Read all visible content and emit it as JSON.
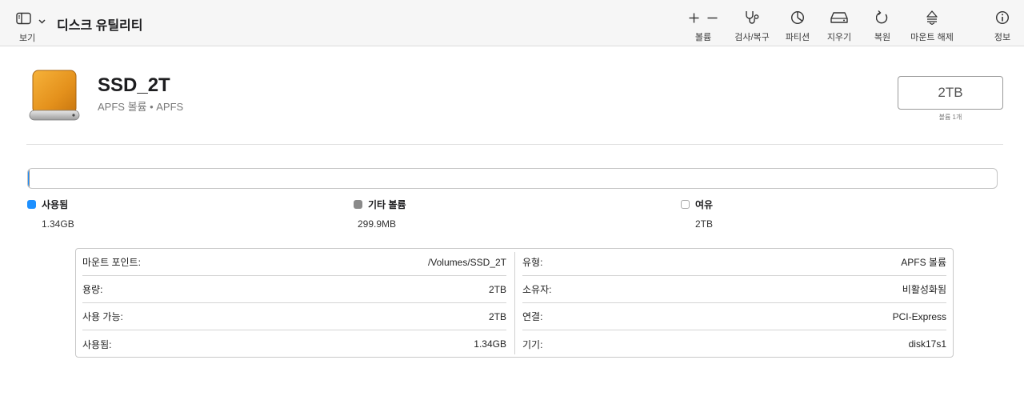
{
  "toolbar": {
    "view_label": "보기",
    "app_title": "디스크 유틸리티",
    "buttons": {
      "volume": "볼륨",
      "first_aid": "검사/복구",
      "partition": "파티션",
      "erase": "지우기",
      "restore": "복원",
      "unmount": "마운트 해제",
      "info": "정보"
    },
    "icons": {
      "view": "sidebar-icon",
      "view_menu": "chevron-down-icon",
      "add": "plus-icon",
      "remove": "minus-icon",
      "first_aid": "stethoscope-icon",
      "partition": "pie-chart-icon",
      "erase": "erase-drive-icon",
      "restore": "restore-arrow-icon",
      "unmount": "eject-icon",
      "info": "info-circle-icon"
    }
  },
  "volume": {
    "name": "SSD_2T",
    "subtitle": "APFS 볼륨 • APFS",
    "capacity": "2TB",
    "volume_count": "볼륨 1개",
    "icon": "external-drive-icon"
  },
  "usage": {
    "used_fraction": 0.00067,
    "other_fraction": 0.00015,
    "legend": [
      {
        "label": "사용됨",
        "value": "1.34GB",
        "color": "#1e90ff"
      },
      {
        "label": "기타 볼륨",
        "value": "299.9MB",
        "color": "#8a8a8a"
      },
      {
        "label": "여유",
        "value": "2TB",
        "color": "#ffffff"
      }
    ]
  },
  "info": {
    "left": [
      {
        "label": "마운트 포인트:",
        "value": "/Volumes/SSD_2T"
      },
      {
        "label": "용량:",
        "value": "2TB"
      },
      {
        "label": "사용 가능:",
        "value": "2TB"
      },
      {
        "label": "사용됨:",
        "value": "1.34GB"
      }
    ],
    "right": [
      {
        "label": "유형:",
        "value": "APFS 볼륨"
      },
      {
        "label": "소유자:",
        "value": "비활성화됨"
      },
      {
        "label": "연결:",
        "value": "PCI-Express"
      },
      {
        "label": "기기:",
        "value": "disk17s1"
      }
    ]
  }
}
